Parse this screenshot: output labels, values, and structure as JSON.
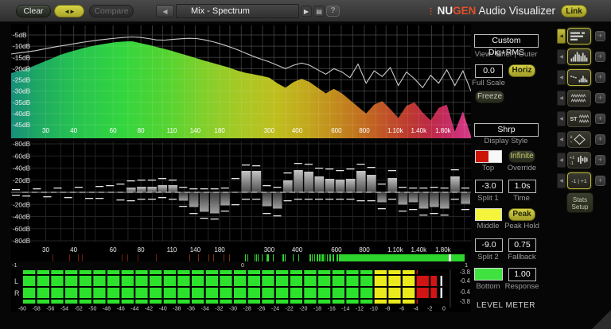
{
  "toolbar": {
    "clear": "Clear",
    "swap_icon": "◄►",
    "compare": "Compare",
    "prev_icon": "◀",
    "preset": "Mix - Spectrum",
    "next_icon": "▶",
    "list_icon": "▤",
    "help": "?",
    "brand": {
      "dots": "⋮",
      "nu": "NU",
      "gen": "GEN",
      "rest": " Audio Visualizer"
    },
    "link": "Link"
  },
  "spectrum": {
    "db_labels": [
      "-5dB",
      "-10dB",
      "-15dB",
      "-20dB",
      "-25dB",
      "-30dB",
      "-35dB",
      "-40dB",
      "-45dB"
    ],
    "freq_labels": [
      {
        "f": 30,
        "t": "30"
      },
      {
        "f": 40,
        "t": "40"
      },
      {
        "f": 60,
        "t": "60"
      },
      {
        "f": 80,
        "t": "80"
      },
      {
        "f": 110,
        "t": "110"
      },
      {
        "f": 140,
        "t": "140"
      },
      {
        "f": 180,
        "t": "180"
      },
      {
        "f": 300,
        "t": "300"
      },
      {
        "f": 400,
        "t": "400"
      },
      {
        "f": 600,
        "t": "600"
      },
      {
        "f": 800,
        "t": "800"
      },
      {
        "f": 1100,
        "t": "1.10k"
      },
      {
        "f": 1400,
        "t": "1.40k"
      },
      {
        "f": 1800,
        "t": "1.80k"
      }
    ],
    "inner_db": [
      -22,
      -21,
      -20,
      -18.5,
      -17,
      -15.5,
      -14,
      -12.8,
      -11.8,
      -10.8,
      -10,
      -9.3,
      -8.7,
      -8.2,
      -7.9,
      -7.8,
      -8.6,
      -9.4,
      -10.3,
      -11.2,
      -12.2,
      -13.3,
      -14.3,
      -15.4,
      -16.5,
      -17.5,
      -18.5,
      -19.5,
      -20.8,
      -21.8,
      -22.5,
      -23.2,
      -24,
      -26.5,
      -28.5,
      -26,
      -24.5,
      -26,
      -28.5,
      -31,
      -29,
      -31,
      -34,
      -37,
      -40,
      -36,
      -34.5,
      -38,
      -42,
      -36.5,
      -35,
      -39.5,
      -43,
      -37.5,
      -36,
      -48,
      -39,
      -50
    ],
    "outer_db": [
      -13.5,
      -13,
      -12.5,
      -12,
      -11.3,
      -10.6,
      -10,
      -9.4,
      -8.8,
      -8.2,
      -7.7,
      -7.2,
      -6.8,
      -6.4,
      -6.1,
      -5.9,
      -6.1,
      -6.6,
      -7.2,
      -7.3,
      -7,
      -6.7,
      -6.5,
      -6.6,
      -7.2,
      -8,
      -9,
      -10.2,
      -11.5,
      -13,
      -14.5,
      -15.8,
      -17,
      -18.5,
      -20,
      -18.5,
      -17.5,
      -18.5,
      -20.5,
      -22.5,
      -20,
      -21.5,
      -24,
      -18,
      -26.5,
      -21,
      -23.5,
      -19.5,
      -27.5,
      -21.5,
      -24.5,
      -28.5,
      -23,
      -26.5,
      -20.5,
      -27.5,
      -21,
      -30
    ],
    "gradient": [
      {
        "o": 0,
        "c": "#17907a"
      },
      {
        "o": 6,
        "c": "#1ea963"
      },
      {
        "o": 14,
        "c": "#27c350"
      },
      {
        "o": 24,
        "c": "#33d53f"
      },
      {
        "o": 34,
        "c": "#55d431"
      },
      {
        "o": 44,
        "c": "#8cce29"
      },
      {
        "o": 52,
        "c": "#afc623"
      },
      {
        "o": 58,
        "c": "#c0bd1e"
      },
      {
        "o": 64,
        "c": "#c2a91d"
      },
      {
        "o": 70,
        "c": "#c28e1d"
      },
      {
        "o": 76,
        "c": "#c2701f"
      },
      {
        "o": 81,
        "c": "#c05526"
      },
      {
        "o": 86,
        "c": "#bd3c2e"
      },
      {
        "o": 90,
        "c": "#bc2c40"
      },
      {
        "o": 94,
        "c": "#c22a5a"
      },
      {
        "o": 97,
        "c": "#cc3076"
      },
      {
        "o": 100,
        "c": "#d63c88"
      }
    ],
    "peak_curve_color": "#cacaca"
  },
  "histogram": {
    "db_labels": [
      "-20dB",
      "-40dB",
      "-60dB",
      "-80dB"
    ],
    "bars": [
      0,
      0,
      0,
      0,
      0,
      0,
      0,
      0,
      0,
      0,
      0,
      6,
      7,
      7,
      9,
      9,
      -10,
      -18,
      -24,
      -26,
      -16,
      0,
      27,
      27,
      -17,
      -20,
      15,
      28,
      26,
      20,
      17,
      16,
      17,
      27,
      22,
      -12,
      18,
      -15,
      -12,
      -20,
      -18,
      -20,
      20,
      -14
    ],
    "peaks_up": [
      2,
      0,
      3,
      0,
      4,
      0,
      5,
      0,
      6,
      7,
      9,
      13,
      14,
      14,
      16,
      14,
      5,
      3,
      3,
      3,
      4,
      16,
      33,
      32,
      7,
      5,
      23,
      35,
      34,
      29,
      28,
      26,
      28,
      34,
      30,
      9,
      26,
      5,
      4,
      4,
      5,
      4,
      27,
      4
    ],
    "peaks_dn": [
      2,
      3,
      0,
      4,
      0,
      5,
      0,
      6,
      6,
      0,
      8,
      9,
      7,
      7,
      5,
      7,
      16,
      25,
      31,
      32,
      22,
      14,
      7,
      7,
      25,
      28,
      9,
      7,
      7,
      7,
      7,
      7,
      7,
      9,
      9,
      19,
      7,
      22,
      20,
      27,
      25,
      27,
      7,
      20
    ]
  },
  "correlation": {
    "min_label": "-1",
    "zero_label": "0",
    "max_label": "1",
    "tick_color": "#2dd42d",
    "marker_color": "#f8f8f8"
  },
  "meter": {
    "channels": [
      "L",
      "R"
    ],
    "scale": [
      "-60",
      "-58",
      "-56",
      "-54",
      "-52",
      "-50",
      "-48",
      "-46",
      "-44",
      "-42",
      "-40",
      "-38",
      "-36",
      "-34",
      "-32",
      "-30",
      "-28",
      "-26",
      "-24",
      "-22",
      "-20",
      "-18",
      "-16",
      "-14",
      "-12",
      "-10",
      "-8",
      "-6",
      "-4",
      "-2",
      "0"
    ],
    "values": [
      "-3.8",
      "-0.4",
      "-0.4",
      "-3.8"
    ],
    "main_level_db": -1.0,
    "rms_level_db": -3.8,
    "peak_hold_db": -0.5,
    "colors": {
      "green": "#2ce22c",
      "yellow": "#eaea1c",
      "red": "#d21414"
    }
  },
  "sidebar": {
    "mode": "Custom Dig+RMS",
    "view": "View: Inner | Outer",
    "offset": "0.0",
    "horiz": "Horiz",
    "full_scale": "Full Scale",
    "freeze": "Freeze",
    "style": "Shrp",
    "display_style": "Display Style",
    "top_label": "Top",
    "override_btn": "Infinite",
    "override_label": "Override",
    "split1": "-3.0",
    "split1_label": "Split 1",
    "time": "1.0s",
    "time_label": "Time",
    "middle_label": "Middle",
    "peak_btn": "Peak",
    "peak_hold_label": "Peak Hold",
    "split2": "-9.0",
    "split2_label": "Split 2",
    "fallback": "0.75",
    "fallback_label": "Fallback",
    "bottom_label": "Bottom",
    "response": "1.00",
    "response_label": "Response",
    "level_meter_title": "LEVEL METER",
    "colors": {
      "top_left": "#cc1507",
      "top_right": "#f8f8f8",
      "middle": "#f4f43c",
      "bottom": "#3fe23f"
    }
  },
  "strip": {
    "plus_label": "+",
    "collapse_icon": "◀",
    "buttons": [
      {
        "name": "meter-view",
        "active": true
      },
      {
        "name": "spectrum-view",
        "active": true
      },
      {
        "name": "spectrum-history-view",
        "active": true
      },
      {
        "name": "spectrogram-view",
        "active": false
      },
      {
        "name": "stereo-spectrogram-view",
        "active": false,
        "label": "ST"
      },
      {
        "name": "vectorscope-view",
        "active": false,
        "plus_text": "+",
        "minus_text": "-"
      },
      {
        "name": "correlation-history-view",
        "active": false,
        "plus_text": "+1",
        "minus_text": "-1"
      },
      {
        "name": "correlation-meter-view",
        "active": true,
        "label": "-1 | +1"
      }
    ],
    "stats_line1": "Stats",
    "stats_line2": "Setup"
  }
}
